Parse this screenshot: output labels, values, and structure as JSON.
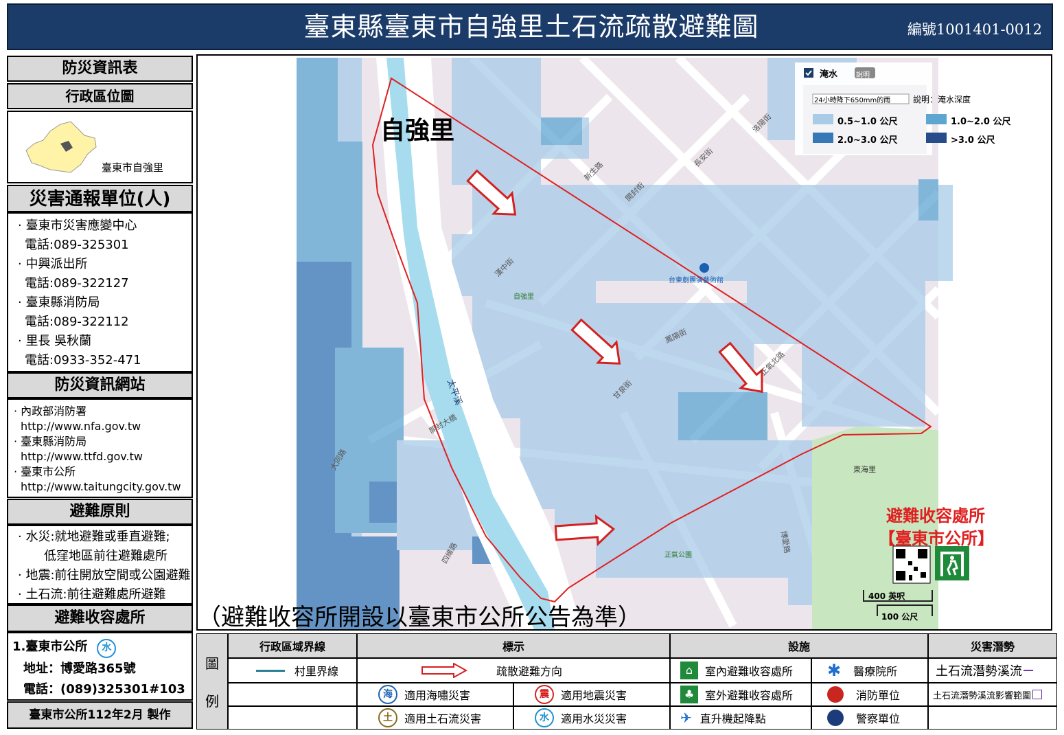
{
  "header": {
    "title": "臺東縣臺東市自強里土石流疏散避難圖",
    "serial": "編號1001401-0012"
  },
  "left_panel": {
    "info_title": "防災資訊表",
    "admin_location_title": "行政區位圖",
    "admin_location_caption": "臺東市自強里",
    "report_units_title": "災害通報單位(人)",
    "report_units": [
      {
        "name": "臺東市災害應變中心",
        "phone": "電話:089-325301"
      },
      {
        "name": "中興派出所",
        "phone": "電話:089-322127"
      },
      {
        "name": "臺東縣消防局",
        "phone": "電話:089-322112"
      },
      {
        "name": "里長 吳秋蘭",
        "phone": "電話:0933-352-471"
      }
    ],
    "websites_title": "防災資訊網站",
    "websites": [
      {
        "name": "內政部消防署",
        "url": "http://www.nfa.gov.tw"
      },
      {
        "name": "臺東縣消防局",
        "url": "http://www.ttfd.gov.tw"
      },
      {
        "name": "臺東市公所",
        "url": "http://www.taitungcity.gov.tw"
      }
    ],
    "principles_title": "避難原則",
    "principles": [
      "水災:就地避難或垂直避難;",
      "低窪地區前往避難處所",
      "地震:前往開放空間或公園避難",
      "土石流:前往避難處所避難"
    ],
    "shelter_title": "避難收容處所",
    "shelter_name": "1.臺東市公所",
    "shelter_badge": "水",
    "shelter_address": "地址：博愛路365號",
    "shelter_phone": "電話：(089)325301#103",
    "made_by": "臺東市公所112年2月 製作"
  },
  "map": {
    "village_label": "自強里",
    "notice": "（避難收容所開設以臺東市公所公告為準）",
    "shelter_label_line1": "避難收容處所",
    "shelter_label_line2": "【臺東市公所】",
    "river_label": "太平溪",
    "park_label": "東海里",
    "scale_ft": "400 英呎",
    "scale_m": "100 公尺",
    "flood_legend": {
      "layer_name": "淹水",
      "explain_btn": "說明",
      "scenario": "24小時降下650mm的雨",
      "desc": "說明：淹水深度",
      "classes": [
        {
          "label": "0.5~1.0 公尺",
          "color": "#a9cbe8"
        },
        {
          "label": "1.0~2.0 公尺",
          "color": "#5ea6d2"
        },
        {
          "label": "2.0~3.0 公尺",
          "color": "#3778b8"
        },
        {
          "label": ">3.0 公尺",
          "color": "#264c8a"
        }
      ]
    },
    "street_labels": [
      "漢中街",
      "新生路",
      "長安街",
      "洛陽街",
      "開封街",
      "正氣北路",
      "甘泉街",
      "鳳陽街",
      "大同路",
      "開封大橋",
      "台東劇團演藝術館",
      "自強里",
      "正氣公園",
      "四維路",
      "博愛路"
    ]
  },
  "legend": {
    "side_label_1": "圖",
    "side_label_2": "例",
    "col_admin": "行政區域界線",
    "col_mark": "標示",
    "col_facility": "設施",
    "col_potential": "災害潛勢",
    "village_boundary": "村里界線",
    "evac_direction": "疏散避難方向",
    "tsunami": "適用海嘯災害",
    "tsunami_icon": "海",
    "earthquake": "適用地震災害",
    "earthquake_icon": "震",
    "debris": "適用土石流災害",
    "debris_icon": "土",
    "flood": "適用水災災害",
    "flood_icon": "水",
    "indoor_shelter": "室內避難收容處所",
    "outdoor_shelter": "室外避難收容處所",
    "helipad": "直升機起降點",
    "medical": "醫療院所",
    "fire_unit": "消防單位",
    "police_unit": "警察單位",
    "debris_stream": "土石流潛勢溪流",
    "debris_area": "土石流潛勢溪流影響範圍"
  }
}
